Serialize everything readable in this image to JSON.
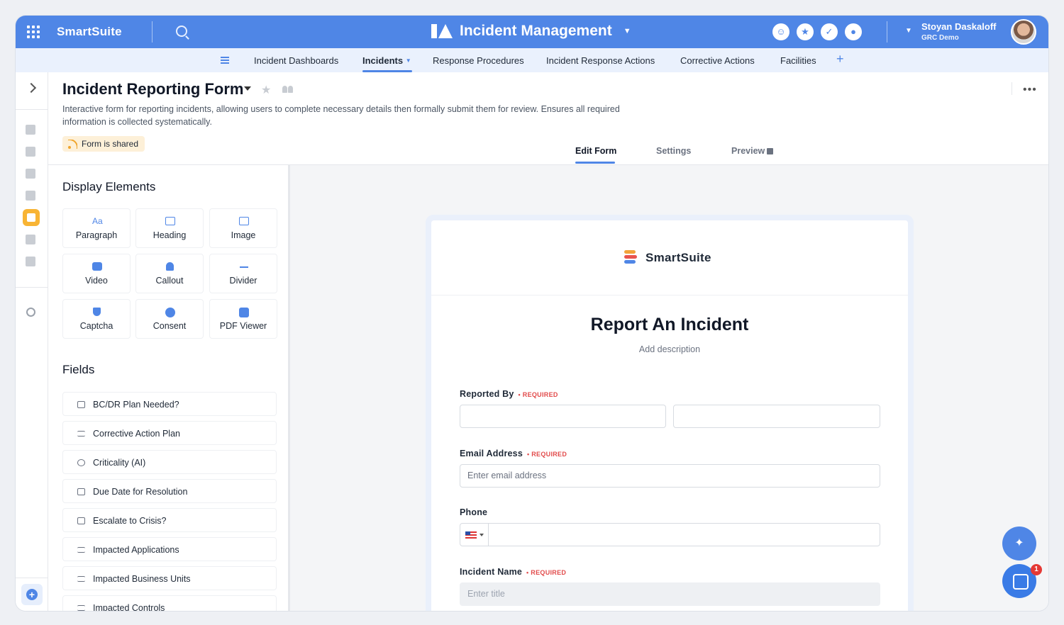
{
  "topbar": {
    "brand": "SmartSuite",
    "solution_title": "Incident Management",
    "user_name": "Stoyan Daskaloff",
    "user_org": "GRC Demo"
  },
  "nav": {
    "tabs": [
      {
        "label": "Incident Dashboards"
      },
      {
        "label": "Incidents",
        "active": true
      },
      {
        "label": "Response Procedures"
      },
      {
        "label": "Incident Response Actions"
      },
      {
        "label": "Corrective Actions"
      },
      {
        "label": "Facilities"
      }
    ]
  },
  "header": {
    "title": "Incident Reporting Form",
    "description": "Interactive form for reporting incidents, allowing users to complete necessary details then formally submit them for review. Ensures all required information is collected systematically.",
    "shared_badge": "Form is shared",
    "form_tabs": [
      "Edit Form",
      "Settings",
      "Preview"
    ]
  },
  "display_elements": {
    "title": "Display Elements",
    "items": [
      {
        "label": "Paragraph",
        "icon": "text-aa-icon"
      },
      {
        "label": "Heading",
        "icon": "heading-icon"
      },
      {
        "label": "Image",
        "icon": "image-icon"
      },
      {
        "label": "Video",
        "icon": "video-icon"
      },
      {
        "label": "Callout",
        "icon": "bell-icon"
      },
      {
        "label": "Divider",
        "icon": "divider-icon"
      },
      {
        "label": "Captcha",
        "icon": "shield-icon"
      },
      {
        "label": "Consent",
        "icon": "check-circle-icon"
      },
      {
        "label": "PDF Viewer",
        "icon": "pdf-icon"
      }
    ]
  },
  "fields": {
    "title": "Fields",
    "items": [
      {
        "label": "BC/DR Plan Needed?",
        "icon": "select-icon"
      },
      {
        "label": "Corrective Action Plan",
        "icon": "linked-record-icon"
      },
      {
        "label": "Criticality (AI)",
        "icon": "circle-check-icon"
      },
      {
        "label": "Due Date for Resolution",
        "icon": "calendar-icon"
      },
      {
        "label": "Escalate to Crisis?",
        "icon": "select-icon"
      },
      {
        "label": "Impacted Applications",
        "icon": "linked-record-icon"
      },
      {
        "label": "Impacted Business Units",
        "icon": "linked-record-icon"
      },
      {
        "label": "Impacted Controls",
        "icon": "linked-record-icon"
      }
    ]
  },
  "form": {
    "brand": "SmartSuite",
    "title": "Report An Incident",
    "description": "Add description",
    "required_label": "• REQUIRED",
    "fields": {
      "reported_by": "Reported By",
      "email": "Email Address",
      "email_placeholder": "Enter email address",
      "phone": "Phone",
      "incident_name": "Incident Name",
      "incident_placeholder": "Enter title"
    }
  },
  "chat": {
    "badge_count": "1"
  },
  "colors": {
    "primary": "#4f86e6",
    "accent": "#f8b434",
    "required": "#e24b4b"
  }
}
